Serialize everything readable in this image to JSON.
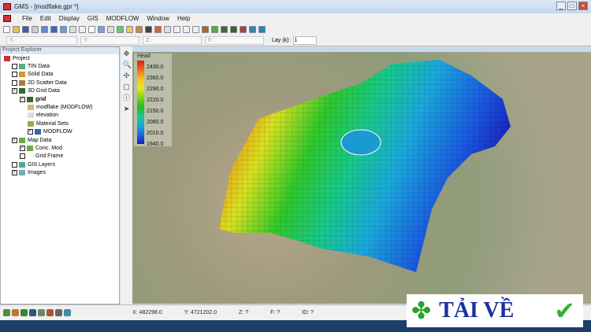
{
  "window": {
    "title": "GMS - [modflake.gpr *]",
    "buttons": [
      "_",
      "□",
      "×"
    ]
  },
  "menu": [
    "File",
    "Edit",
    "Display",
    "GIS",
    "MODFLOW",
    "Window",
    "Help"
  ],
  "coords": {
    "x_label": "X:",
    "y_label": "Y:",
    "z_label": "Z:",
    "f_label": "F:",
    "lay_label": "Lay (k):",
    "lay_value": "1"
  },
  "explorer": {
    "title": "Project Explorer",
    "items": [
      {
        "label": "Project",
        "checked": null
      },
      {
        "label": "TIN Data",
        "checked": false
      },
      {
        "label": "Solid Data",
        "checked": false
      },
      {
        "label": "2D Scatter Data",
        "checked": false
      },
      {
        "label": "3D Grid Data",
        "checked": true
      },
      {
        "label": "grid",
        "checked": true
      },
      {
        "label": "modflake (MODFLOW)",
        "checked": null
      },
      {
        "label": "elevation",
        "checked": null
      },
      {
        "label": "Material Sets",
        "checked": null
      },
      {
        "label": "MODFLOW",
        "checked": true
      },
      {
        "label": "Map Data",
        "checked": true
      },
      {
        "label": "Conc. Mod",
        "checked": true
      },
      {
        "label": "Grid Frame",
        "checked": false
      },
      {
        "label": "GIS Layers",
        "checked": false
      },
      {
        "label": "Images",
        "checked": true
      }
    ]
  },
  "legend": {
    "title": "Head",
    "ticks": [
      "2430.0",
      "2360.0",
      "2290.0",
      "2220.0",
      "2150.0",
      "2080.0",
      "2010.0",
      "1940.0"
    ]
  },
  "status": {
    "x": "X: 482298.0",
    "y": "Y: 4721202.0",
    "z": "Z: ?",
    "f": "F: ?",
    "id": "ID: ?"
  },
  "watermark": {
    "text": "TẢI VỀ"
  }
}
